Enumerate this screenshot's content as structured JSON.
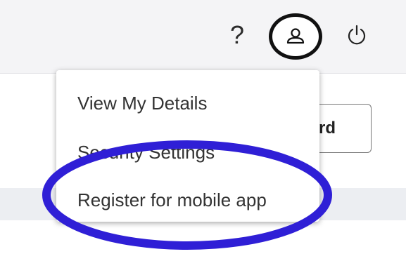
{
  "header": {
    "help_icon": "?",
    "avatar_icon": "user-icon",
    "power_icon": "power-icon"
  },
  "content": {
    "partial_button_label": "rd"
  },
  "dropdown": {
    "items": [
      {
        "label": "View My Details"
      },
      {
        "label": "Security Settings"
      },
      {
        "label": "Register for mobile app"
      }
    ]
  },
  "annotation": {
    "highlight_color": "#2f1fd6"
  }
}
